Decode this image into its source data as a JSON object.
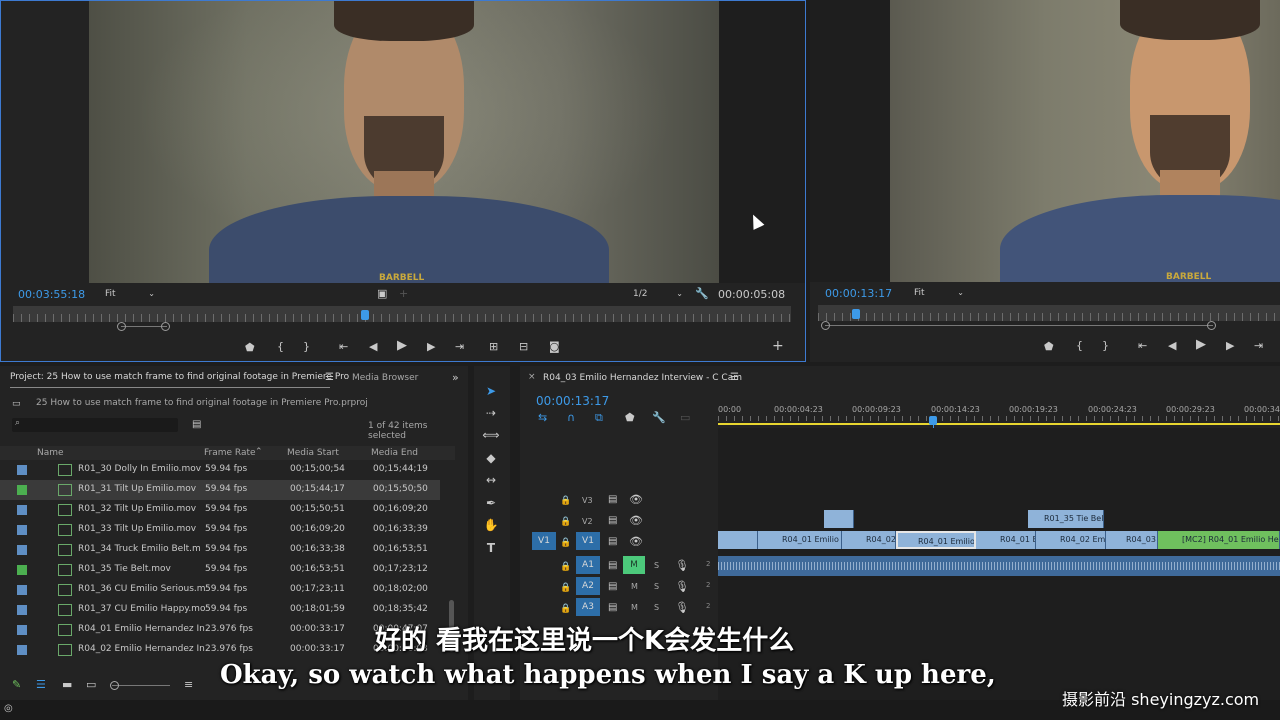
{
  "source_monitor": {
    "timecode": "00:03:55:18",
    "fit": "Fit",
    "resolution": "1/2",
    "duration": "00:00:05:08",
    "shirt_text": "BARBELL"
  },
  "program_monitor": {
    "timecode": "00:00:13:17",
    "fit": "Fit",
    "shirt_text": "BARBELL"
  },
  "project": {
    "tab_label": "Project: 25 How to use match frame to find original footage in Premiere Pro",
    "media_browser_tab": "Media Browser",
    "file_name": "25 How to use match frame to find original footage in Premiere Pro.prproj",
    "selection_count": "1 of 42 items selected",
    "columns": [
      "Name",
      "Frame Rate",
      "Media Start",
      "Media End"
    ],
    "rows": [
      {
        "name": "R01_30 Dolly In Emilio.mov",
        "rate": "59.94 fps",
        "start": "00;15;00;54",
        "end": "00;15;44;19",
        "color": "#5f8fc4"
      },
      {
        "name": "R01_31 Tilt Up Emilio.mov",
        "rate": "59.94 fps",
        "start": "00;15;44;17",
        "end": "00;15;50;50",
        "color": "#4caf50"
      },
      {
        "name": "R01_32 Tilt Up Emilio.mov",
        "rate": "59.94 fps",
        "start": "00;15;50;51",
        "end": "00;16;09;20",
        "color": "#5f8fc4"
      },
      {
        "name": "R01_33 Tilt Up Emilio.mov",
        "rate": "59.94 fps",
        "start": "00;16;09;20",
        "end": "00;16;33;39",
        "color": "#5f8fc4"
      },
      {
        "name": "R01_34 Truck Emilio Belt.m",
        "rate": "59.94 fps",
        "start": "00;16;33;38",
        "end": "00;16;53;51",
        "color": "#5f8fc4"
      },
      {
        "name": "R01_35 Tie Belt.mov",
        "rate": "59.94 fps",
        "start": "00;16;53;51",
        "end": "00;17;23;12",
        "color": "#4caf50"
      },
      {
        "name": "R01_36 CU Emilio Serious.m",
        "rate": "59.94 fps",
        "start": "00;17;23;11",
        "end": "00;18;02;00",
        "color": "#5f8fc4"
      },
      {
        "name": "R01_37 CU Emilio Happy.mo",
        "rate": "59.94 fps",
        "start": "00;18;01;59",
        "end": "00;18;35;42",
        "color": "#5f8fc4"
      },
      {
        "name": "R04_01 Emilio Hernandez In",
        "rate": "23.976 fps",
        "start": "00:00:33:17",
        "end": "00:00:47:07",
        "color": "#5f8fc4"
      },
      {
        "name": "R04_02 Emilio Hernandez In",
        "rate": "23.976 fps",
        "start": "00:00:33:17",
        "end": "00:00:40:03",
        "color": "#5f8fc4"
      }
    ]
  },
  "timeline": {
    "sequence_name": "R04_03 Emilio Hernandez Interview - C Cam",
    "timecode": "00:00:13:17",
    "ruler": [
      "00:00",
      "00:00:04:23",
      "00:00:09:23",
      "00:00:14:23",
      "00:00:19:23",
      "00:00:24:23",
      "00:00:29:23",
      "00:00:34"
    ],
    "tracks": {
      "v3": "V3",
      "v2": "V2",
      "v1": "V1",
      "v1_src": "V1",
      "a1": "A1",
      "a2": "A2",
      "a3": "A3",
      "mute": "M",
      "solo": "S"
    },
    "clips": {
      "c1": "R04_01 Emilio H",
      "c2": "R04_02",
      "c3": "R04_01 Emilio",
      "c4": "R04_01 E",
      "c5": "R04_02 Emil",
      "c6": "R04_03",
      "c7": "[MC2] R04_01 Emilio Hernandez",
      "v2b": "R01_35 Tie Bel"
    }
  },
  "subtitles": {
    "chinese": "好的 看我在这里说一个K会发生什么",
    "english": "Okay, so watch what happens when I say a K up here,"
  },
  "watermark": "摄影前沿 sheyingzyz.com",
  "colors": {
    "accent": "#3d9ae8",
    "playhead": "#3d9ae8",
    "clip_video": "#8fb3d9",
    "clip_mc": "#6fc05e",
    "work_area": "#e8d630"
  }
}
